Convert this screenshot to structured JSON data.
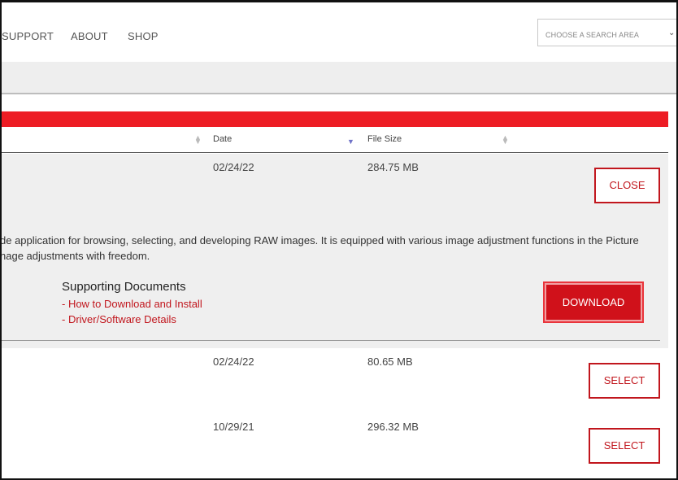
{
  "nav": {
    "items": [
      "SUPPORT",
      "ABOUT",
      "SHOP"
    ],
    "search_placeholder": "CHOOSE A SEARCH AREA"
  },
  "table": {
    "headers": {
      "date": "Date",
      "file_size": "File Size"
    },
    "expanded_row": {
      "date": "02/24/22",
      "file_size": "284.75 MB",
      "close_label": "CLOSE",
      "description_line1": "de application for browsing, selecting, and developing RAW images. It is equipped with various image adjustment functions in the Picture",
      "description_line2": "nage adjustments with freedom.",
      "supporting_title": "Supporting Documents",
      "links": [
        "- How to Download and Install",
        "- Driver/Software Details"
      ],
      "download_label": "DOWNLOAD"
    },
    "rows": [
      {
        "date": "02/24/22",
        "file_size": "80.65 MB",
        "action": "SELECT"
      },
      {
        "date": "10/29/21",
        "file_size": "296.32 MB",
        "action": "SELECT"
      }
    ]
  },
  "colors": {
    "brand_red": "#ed1c24",
    "button_red": "#c1161d",
    "sort_active": "#6f72c8"
  }
}
